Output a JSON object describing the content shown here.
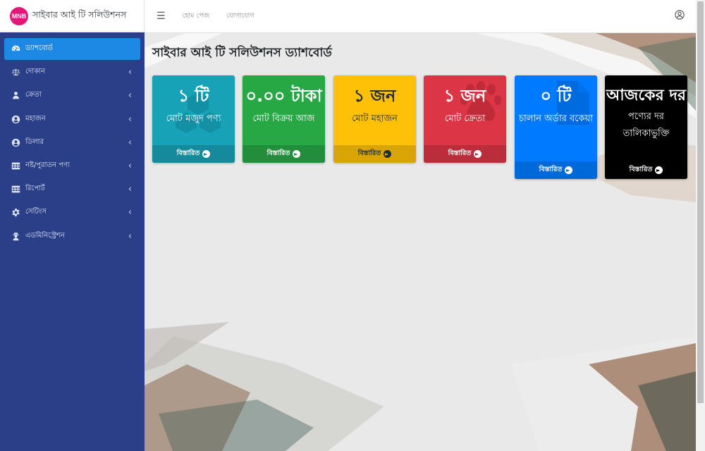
{
  "brand": {
    "logo_text": "MNB",
    "name": "সাইবার আই টি সলিউশনস"
  },
  "topbar": {
    "links": [
      "হোম পেজ",
      "যোগাযোগ"
    ]
  },
  "sidebar": {
    "items": [
      {
        "label": "ড্যাশবোর্ড",
        "icon": "dashboard-icon",
        "active": true
      },
      {
        "label": "দোকান",
        "icon": "balance-scale-icon"
      },
      {
        "label": "ক্রেতা",
        "icon": "user-icon"
      },
      {
        "label": "মহাজন",
        "icon": "user-circle-icon"
      },
      {
        "label": "ডিলার",
        "icon": "user-circle-icon"
      },
      {
        "label": "নষ্ট/পুরাতন পণ্য",
        "icon": "table-icon"
      },
      {
        "label": "রিপোর্ট",
        "icon": "table-icon"
      },
      {
        "label": "সেটিংস",
        "icon": "gear-icon"
      },
      {
        "label": "এডমিনিস্ট্রেশন",
        "icon": "user-secret-icon"
      }
    ]
  },
  "page": {
    "title": "সাইবার আই টি সলিউশনস ড্যাশবোর্ড"
  },
  "cards": [
    {
      "main": "১ টি",
      "sub": "মোট মজুদ পণ্য",
      "footer": "বিস্তারিত",
      "bg": "#17a2b8",
      "footer_bg": "#148a9c",
      "text_color": "#ffffff",
      "icon": "cubes-icon"
    },
    {
      "main": "০.০০ টাকা",
      "sub": "মোট বিক্রয় আজ",
      "footer": "বিস্তারিত",
      "bg": "#28a745",
      "footer_bg": "#228e3b",
      "text_color": "#ffffff"
    },
    {
      "main": "১ জন",
      "sub": "মোট মহাজন",
      "footer": "বিস্তারিত",
      "bg": "#ffc107",
      "footer_bg": "#d9a406",
      "text_color": "#1f2d3d"
    },
    {
      "main": "১ জন",
      "sub": "মোট ক্রেতা",
      "footer": "বিস্তারিত",
      "bg": "#dc3545",
      "footer_bg": "#bb2d3b",
      "text_color": "#ffffff",
      "icon": "paw-icon"
    },
    {
      "main": "০ টি",
      "sub": "চালান অর্ডার বকেয়া",
      "footer": "বিস্তারিত",
      "bg": "#007bff",
      "footer_bg": "#0069d9",
      "text_color": "#ffffff",
      "icon": "file-icon"
    },
    {
      "main": "আজকের দর",
      "sub": "পণ্যের দর তালিকাভুক্তি",
      "footer": "বিস্তারিত",
      "bg": "#000000",
      "footer_bg": "#000000",
      "text_color": "#ffffff"
    }
  ]
}
